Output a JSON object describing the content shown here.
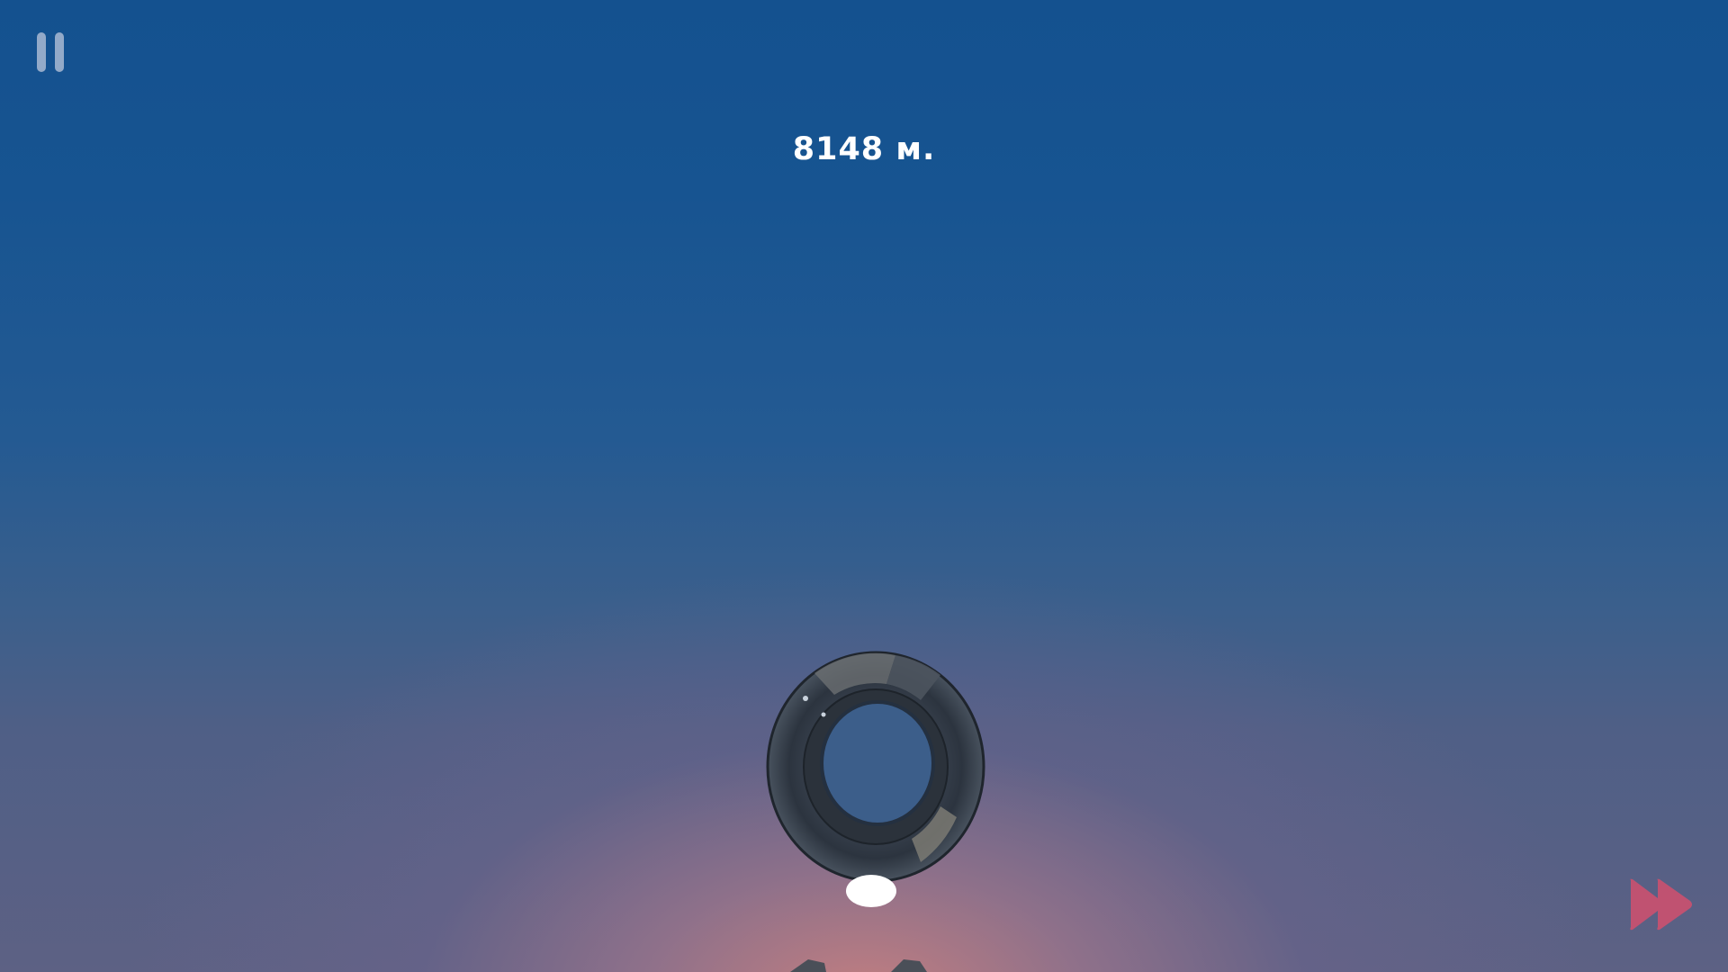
{
  "hud": {
    "distance_text": "8148 м.",
    "pause_icon": "pause-icon",
    "fast_forward_icon": "fast-forward-icon"
  },
  "scene": {
    "object": "tire-icon"
  },
  "colors": {
    "sky_top": "#14518f",
    "sky_horizon_glow": "#c88080",
    "hud_text": "#ffffff",
    "pause_button": "#bec8dc",
    "fast_forward_button": "#d2506e"
  }
}
